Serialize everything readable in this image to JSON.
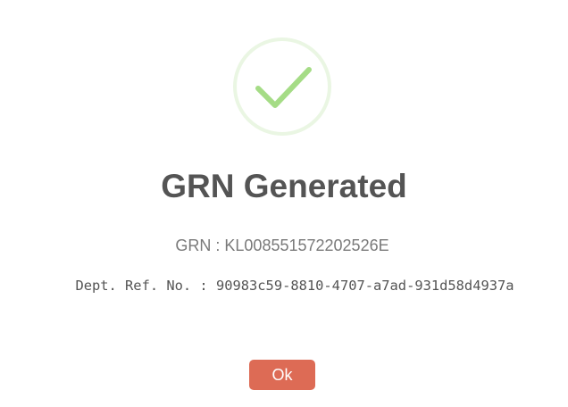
{
  "dialog": {
    "icon": "success-check-icon",
    "title": "GRN Generated",
    "grn_text": "GRN : KL008551572202526E",
    "dept_ref_text": "Dept. Ref. No. : 90983c59-8810-4707-a7ad-931d58d4937a",
    "ok_label": "Ok"
  },
  "colors": {
    "success_ring": "#e6f4dc",
    "success_check": "#a5dc86",
    "title": "#545454",
    "grn_text": "#797979",
    "ok_button": "#dd6b55"
  }
}
